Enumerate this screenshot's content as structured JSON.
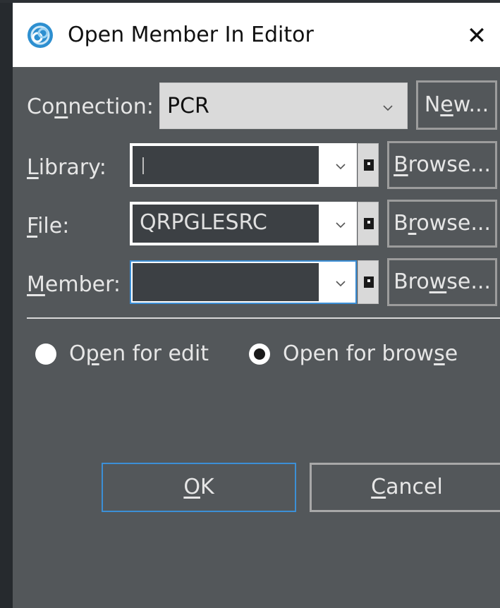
{
  "window": {
    "title": "Open Member In Editor",
    "icon": "app-logo-icon",
    "close_icon": "close-icon"
  },
  "connection": {
    "label_pre": "Co",
    "label_mn": "n",
    "label_post": "nection:",
    "value": "PCR",
    "new_pre": "N",
    "new_mn": "e",
    "new_post": "w..."
  },
  "library": {
    "label_mn": "L",
    "label_post": "ibrary:",
    "value": "",
    "browse_mn": "B",
    "browse_post": "rowse..."
  },
  "file": {
    "label_mn": "F",
    "label_post": "ile:",
    "value": "QRPGLESRC",
    "browse_pre": "B",
    "browse_mn": "r",
    "browse_post": "owse..."
  },
  "member": {
    "label_mn": "M",
    "label_post": "ember:",
    "value": "",
    "browse_pre": "Bro",
    "browse_mn": "w",
    "browse_post": "se..."
  },
  "options": {
    "edit_pre": "O",
    "edit_mn": "p",
    "edit_post": "en for edit",
    "browse_pre": "Open for brow",
    "browse_mn": "s",
    "browse_post": "e",
    "selected": "browse"
  },
  "actions": {
    "ok_mn": "O",
    "ok_post": "K",
    "cancel_mn": "C",
    "cancel_post": "ancel"
  },
  "colors": {
    "dialog_bg": "#53575a",
    "field_bg": "#3c4044",
    "focus_accent": "#3c8fd6",
    "icon_blue": "#2d8fd0"
  }
}
